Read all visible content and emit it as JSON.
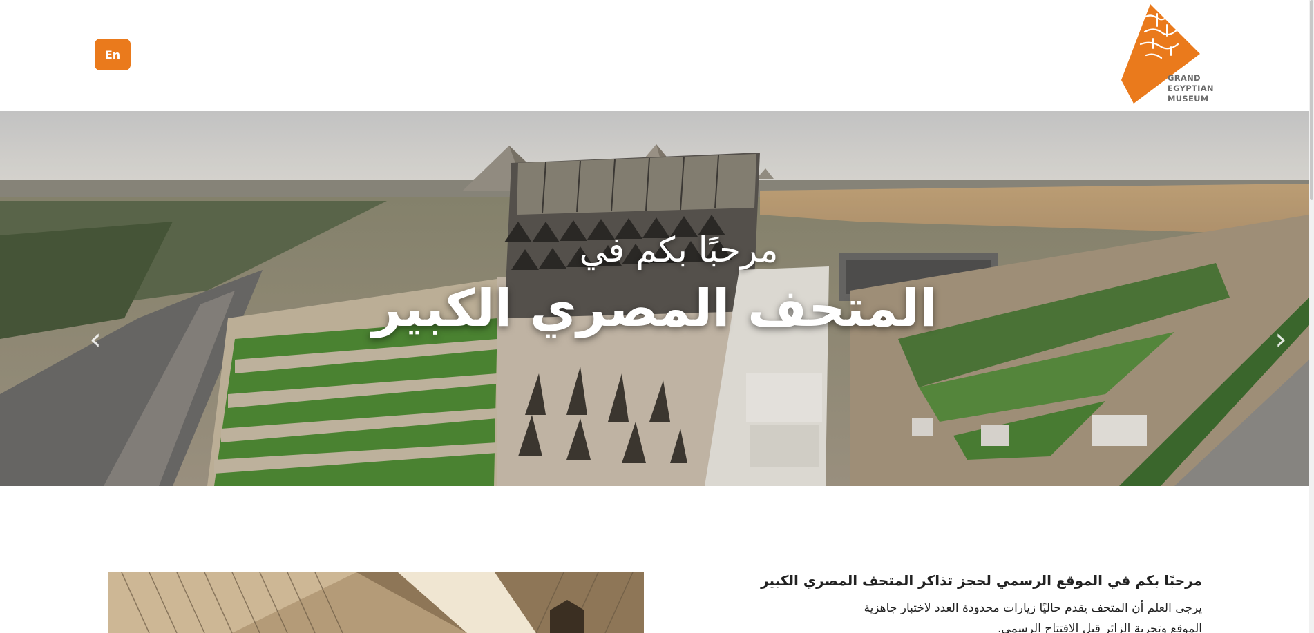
{
  "header": {
    "lang_button": "En",
    "logo": {
      "icon": "gem-logo-icon",
      "brand_color": "#ea7a1c",
      "lines": [
        "GRAND",
        "EGYPTIAN",
        "MUSEUM"
      ]
    }
  },
  "hero": {
    "subtitle": "مرحبًا بكم في",
    "title": "المتحف المصري الكبير",
    "prev_icon": "chevron-left-icon",
    "next_icon": "chevron-right-icon",
    "prev_glyph": "‹",
    "next_glyph": "›"
  },
  "intro": {
    "heading": "مرحبًا بكم في الموقع الرسمي لحجز تذاكر المتحف المصري الكبير",
    "body": "يرجى العلم أن المتحف يقدم حاليًا زيارات محدودة العدد لاختبار جاهزية الموقع وتجربة الزائر قبل الافتتاح الرسمي."
  },
  "colors": {
    "accent": "#ea7a1c",
    "logo_text": "#6b6b6b"
  }
}
